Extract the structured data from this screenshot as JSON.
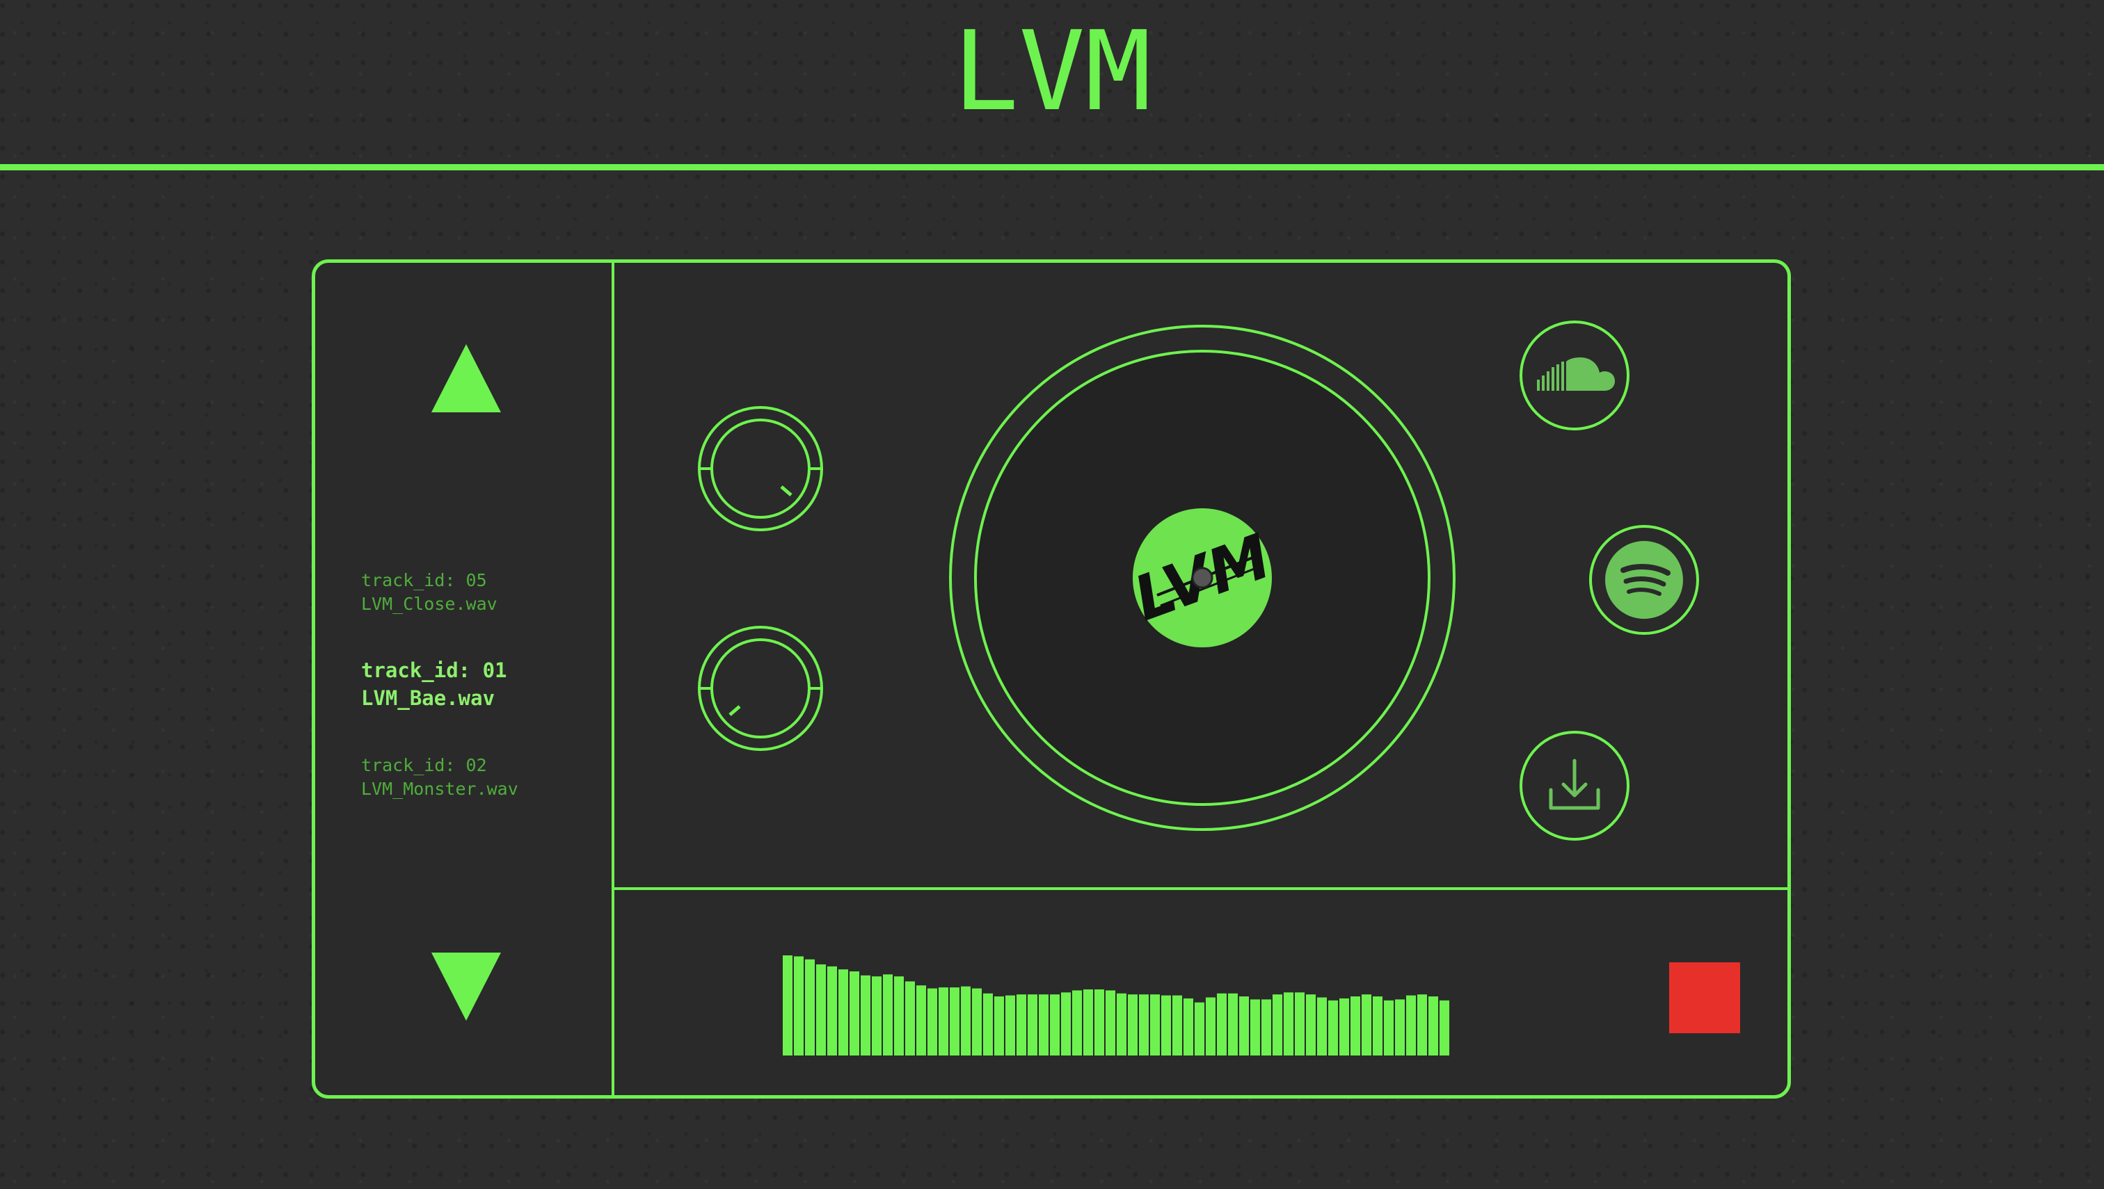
{
  "header": {
    "title": "LVM"
  },
  "colors": {
    "accent": "#6ef24f",
    "background": "#2d2d2d",
    "panel": "#2a2a2a",
    "stop": "#e8302a"
  },
  "playlist": {
    "up_icon": "triangle-up-icon",
    "down_icon": "triangle-down-icon",
    "tracks": [
      {
        "id": "track_id: 05",
        "file": "LVM_Close.wav",
        "active": false
      },
      {
        "id": "track_id: 01",
        "file": "LVM_Bae.wav",
        "active": true
      },
      {
        "id": "track_id: 02",
        "file": "LVM_Monster.wav",
        "active": false
      }
    ]
  },
  "knobs": [
    {
      "name": "knob-1",
      "level": 0.62
    },
    {
      "name": "knob-2",
      "level": 0.38
    }
  ],
  "turntable": {
    "record_label": "LVM"
  },
  "links": [
    {
      "icon": "soundcloud-icon"
    },
    {
      "icon": "spotify-icon"
    },
    {
      "icon": "download-icon"
    }
  ],
  "waveform": {
    "levels": [
      1.0,
      0.99,
      0.96,
      0.91,
      0.89,
      0.86,
      0.84,
      0.8,
      0.79,
      0.81,
      0.79,
      0.74,
      0.7,
      0.67,
      0.68,
      0.68,
      0.69,
      0.67,
      0.62,
      0.59,
      0.6,
      0.61,
      0.61,
      0.61,
      0.61,
      0.63,
      0.65,
      0.66,
      0.66,
      0.65,
      0.62,
      0.61,
      0.61,
      0.61,
      0.6,
      0.6,
      0.57,
      0.53,
      0.58,
      0.62,
      0.62,
      0.59,
      0.56,
      0.56,
      0.61,
      0.63,
      0.63,
      0.61,
      0.58,
      0.55,
      0.57,
      0.59,
      0.61,
      0.59,
      0.55,
      0.56,
      0.6,
      0.61,
      0.59,
      0.55
    ]
  },
  "controls": {
    "stop_icon": "stop-icon"
  }
}
